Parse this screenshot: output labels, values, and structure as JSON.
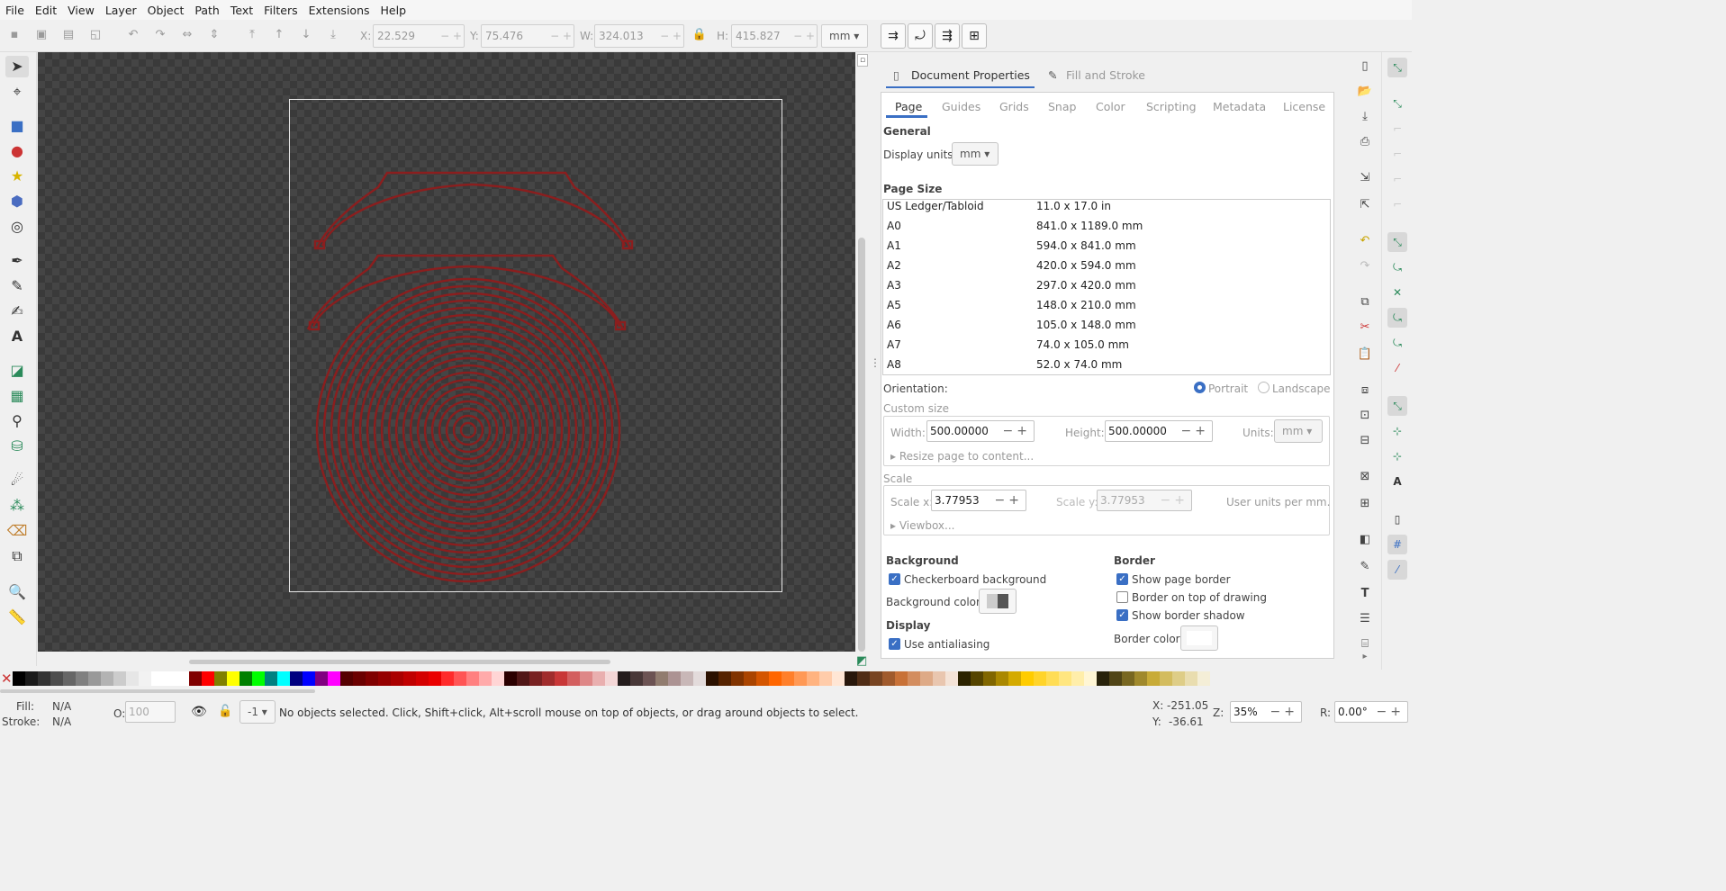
{
  "menu": [
    "File",
    "Edit",
    "View",
    "Layer",
    "Object",
    "Path",
    "Text",
    "Filters",
    "Extensions",
    "Help"
  ],
  "toolctrl": {
    "x_label": "X:",
    "x_value": "22.529",
    "y_label": "Y:",
    "y_value": "75.476",
    "w_label": "W:",
    "w_value": "324.013",
    "h_label": "H:",
    "h_value": "415.827",
    "units": "mm"
  },
  "dock": {
    "tabs": [
      "Document Properties",
      "Fill and Stroke"
    ],
    "page_tabs": [
      "Page",
      "Guides",
      "Grids",
      "Snap",
      "Color",
      "Scripting",
      "Metadata",
      "License"
    ],
    "general_heading": "General",
    "display_units_label": "Display units:",
    "display_units_value": "mm",
    "page_size_heading": "Page Size",
    "page_sizes": [
      {
        "name": "US Ledger/Tabloid",
        "size": "11.0 x 17.0 in"
      },
      {
        "name": "A0",
        "size": "841.0 x 1189.0 mm"
      },
      {
        "name": "A1",
        "size": "594.0 x 841.0 mm"
      },
      {
        "name": "A2",
        "size": "420.0 x 594.0 mm"
      },
      {
        "name": "A3",
        "size": "297.0 x 420.0 mm"
      },
      {
        "name": "A5",
        "size": "148.0 x 210.0 mm"
      },
      {
        "name": "A6",
        "size": "105.0 x 148.0 mm"
      },
      {
        "name": "A7",
        "size": "74.0 x 105.0 mm"
      },
      {
        "name": "A8",
        "size": "52.0 x 74.0 mm"
      }
    ],
    "orientation_label": "Orientation:",
    "portrait": "Portrait",
    "landscape": "Landscape",
    "custom_size_heading": "Custom size",
    "width_label": "Width:",
    "width_value": "500.00000",
    "height_label": "Height:",
    "height_value": "500.00000",
    "units_label": "Units:",
    "units_value": "mm",
    "resize_label": "Resize page to content...",
    "scale_heading": "Scale",
    "scale_x_label": "Scale x:",
    "scale_x_value": "3.77953",
    "scale_y_label": "Scale y:",
    "scale_y_value": "3.77953",
    "user_units_label": "User units per mm.",
    "viewbox_label": "Viewbox...",
    "background_heading": "Background",
    "checkerboard_label": "Checkerboard background",
    "bg_color_label": "Background color:",
    "display_heading": "Display",
    "antialias_label": "Use antialiasing",
    "border_heading": "Border",
    "show_border_label": "Show page border",
    "border_top_label": "Border on top of drawing",
    "border_shadow_label": "Show border shadow",
    "border_color_label": "Border color:"
  },
  "status": {
    "fill_label": "Fill:",
    "fill_value": "N/A",
    "stroke_label": "Stroke:",
    "stroke_value": "N/A",
    "opacity_label": "O:",
    "opacity_value": "100",
    "layer_value": "-1",
    "message": "No objects selected. Click, Shift+click, Alt+scroll mouse on top of objects, or drag around objects to select.",
    "x_label": "X:",
    "x_value": "-251.05",
    "y_label": "Y:",
    "y_value": "-36.61",
    "zoom_label": "Z:",
    "zoom_value": "35%",
    "rot_label": "R:",
    "rot_value": "0.00°"
  },
  "colors": {
    "accent": "#3a6fc4",
    "drawing_stroke": "#8b1e1e",
    "palette": [
      "#000000",
      "#1a1a1a",
      "#333333",
      "#4d4d4d",
      "#666666",
      "#808080",
      "#999999",
      "#b3b3b3",
      "#cccccc",
      "#e6e6e6",
      "#f2f2f2",
      "#ffffff",
      "#ffffff",
      "#ffffff",
      "#800000",
      "#ff0000",
      "#808000",
      "#ffff00",
      "#008000",
      "#00ff00",
      "#008080",
      "#00ffff",
      "#000080",
      "#0000ff",
      "#800080",
      "#ff00ff",
      "#550000",
      "#6b0000",
      "#800000",
      "#950000",
      "#aa0000",
      "#c00000",
      "#d40000",
      "#ea0000",
      "#ff2a2a",
      "#ff5555",
      "#ff8080",
      "#ffaaaa",
      "#ffd5d5",
      "#2b0000",
      "#501616",
      "#782121",
      "#a02c2c",
      "#c83737",
      "#d35f5f",
      "#de8787",
      "#e9afaf",
      "#f4d7d7",
      "#241c1c",
      "#483737",
      "#6c5353",
      "#917c6f",
      "#ac9393",
      "#c8b7b7",
      "#e3dbdb",
      "#2b1100",
      "#552200",
      "#803300",
      "#aa4400",
      "#d45500",
      "#ff6600",
      "#ff7f2a",
      "#ff9955",
      "#ffb380",
      "#ffccaa",
      "#ffe6d5",
      "#28170b",
      "#502d16",
      "#784421",
      "#a05a2c",
      "#c87137",
      "#d38d5f",
      "#deaa87",
      "#e9c6af",
      "#f4e3d7",
      "#2b2200",
      "#554400",
      "#806600",
      "#aa8800",
      "#d4aa00",
      "#ffcc00",
      "#ffd42a",
      "#ffdd55",
      "#ffe680",
      "#ffeeaa",
      "#fff6d5",
      "#28220b",
      "#504416",
      "#786721",
      "#a0892c",
      "#c8ab37",
      "#d3bc5f",
      "#decd87",
      "#e9ddaf",
      "#f4eed7"
    ]
  }
}
